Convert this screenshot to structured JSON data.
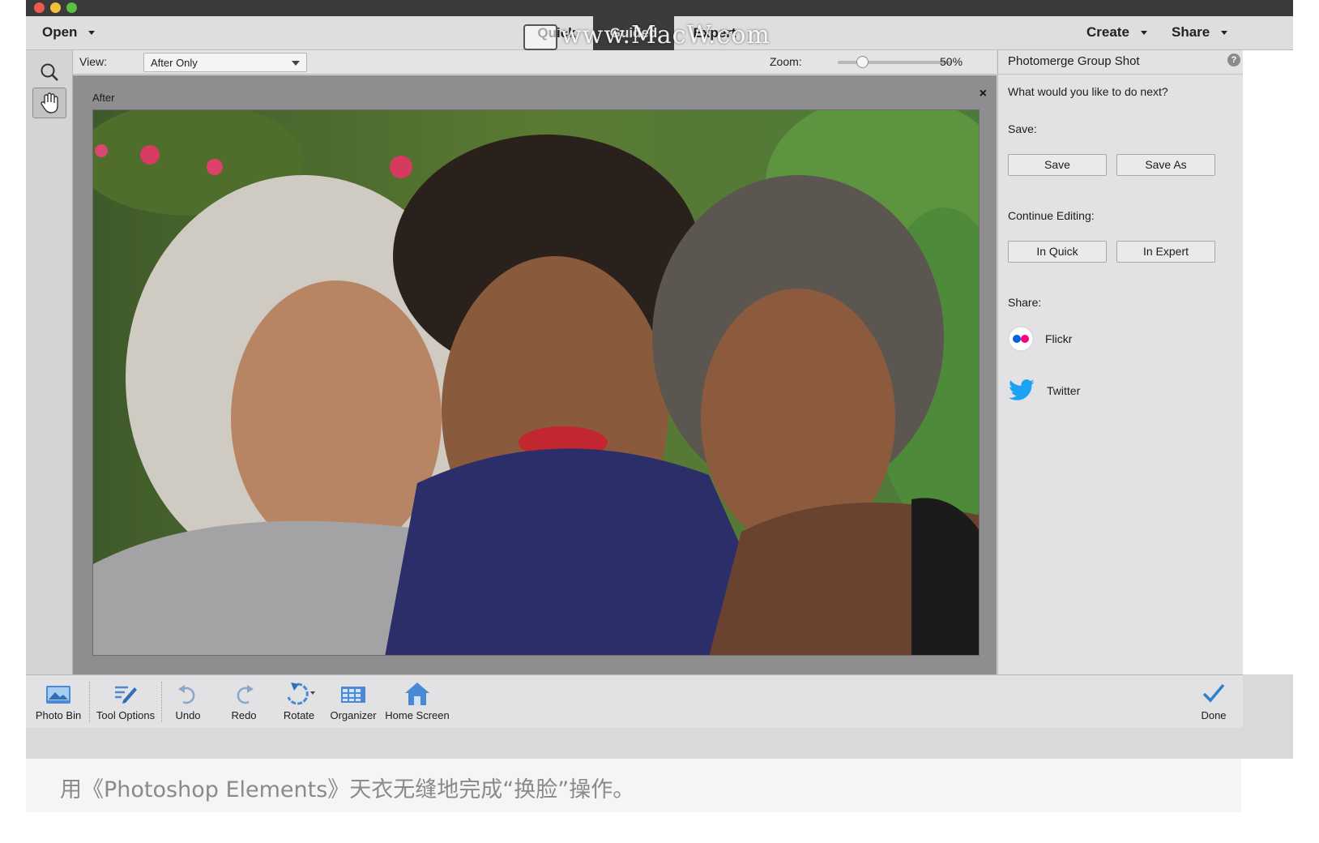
{
  "menubar": {
    "open_label": "Open",
    "create_label": "Create",
    "share_label": "Share",
    "modes": [
      "Quick",
      "Guided",
      "Expert"
    ],
    "active_mode": "Guided",
    "watermark": "www.MacW.com"
  },
  "options": {
    "view_label": "View:",
    "view_value": "After Only",
    "zoom_label": "Zoom:",
    "zoom_value": "50%",
    "zoom_fraction": 0.18
  },
  "canvas": {
    "after_label": "After",
    "close_glyph": "×"
  },
  "panel": {
    "title": "Photomerge Group Shot",
    "help_glyph": "?",
    "prompt": "What would you like to do next?",
    "save_heading": "Save:",
    "save_button": "Save",
    "save_as_button": "Save As",
    "continue_heading": "Continue Editing:",
    "in_quick_button": "In Quick",
    "in_expert_button": "In Expert",
    "share_heading": "Share:",
    "flickr_label": "Flickr",
    "twitter_label": "Twitter"
  },
  "bottombar": {
    "photo_bin": "Photo Bin",
    "tool_options": "Tool Options",
    "undo": "Undo",
    "redo": "Redo",
    "rotate": "Rotate",
    "organizer": "Organizer",
    "home_screen": "Home Screen",
    "done": "Done"
  },
  "caption": "用《Photoshop Elements》天衣无缝地完成“换脸”操作。",
  "colors": {
    "active_tab": "#3b3b3d",
    "accent_blue": "#2f7fd1",
    "twitter_blue": "#1da1f2",
    "flickr_blue": "#0063dc",
    "flickr_pink": "#ff0084"
  }
}
